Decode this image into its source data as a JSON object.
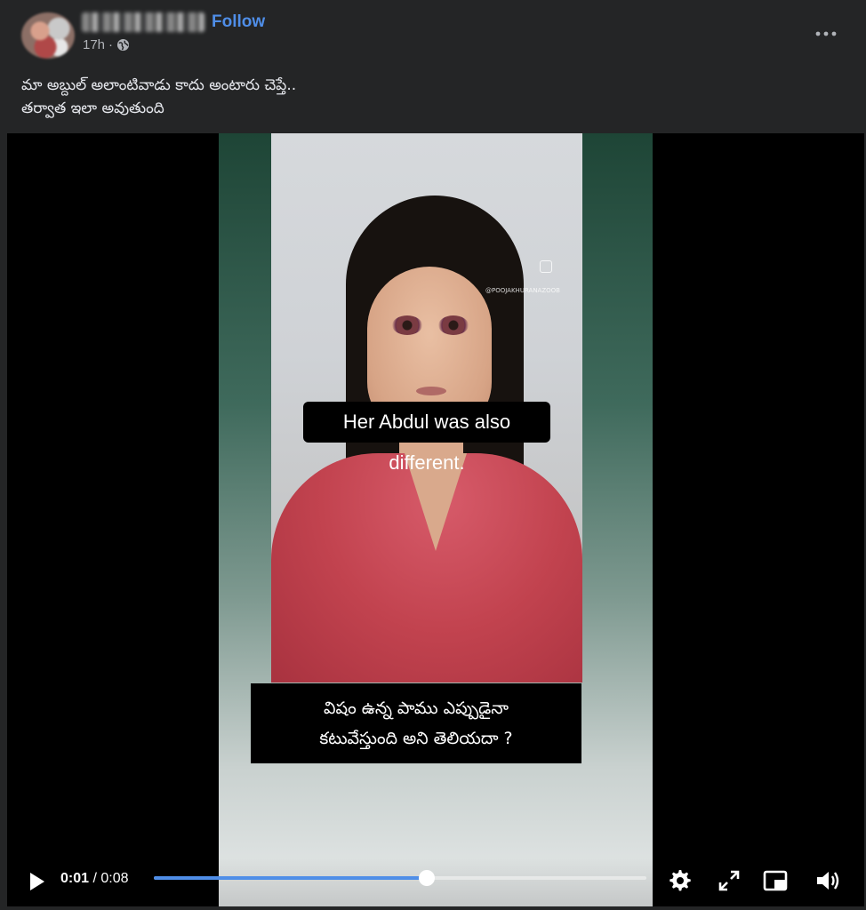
{
  "post": {
    "follow_label": "Follow",
    "time": "17h",
    "separator": "·",
    "visibility_icon": "globe-icon",
    "more_icon": "more-options-icon",
    "caption": "మా అబ్దుల్ అలాంటివాడు కాదు అంటారు చెప్తే..\nతర్వాత ఇలా అవుతుంది"
  },
  "video": {
    "watermark": "@POOJAKHURANAZOOB",
    "subtitle_en": "Her Abdul was also different.",
    "subtitle_te": "విషం ఉన్న పాము ఎప్పుడైనా\nకటువేస్తుంది  అని  తెలియదా  ?",
    "current_time": "0:01",
    "time_separator": " / ",
    "duration": "0:08",
    "progress_fraction": 0.555,
    "icons": [
      "play-icon",
      "settings-icon",
      "fullscreen-icon",
      "picture-in-picture-icon",
      "volume-icon"
    ]
  },
  "colors": {
    "background": "#242526",
    "accent": "#4f8ee8",
    "text": "#e4e6eb",
    "muted": "#b0b3b8"
  }
}
